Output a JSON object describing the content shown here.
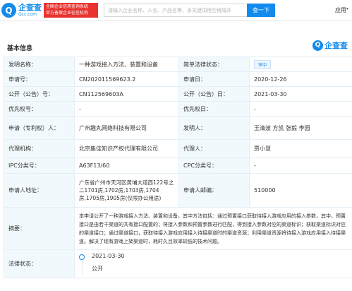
{
  "header": {
    "logo_mark": "Q",
    "logo_cn": "企查查",
    "logo_en": "Qcc.com",
    "banner_line1": "全国企业信用查询系统",
    "banner_line2": "官方备案企业征信机构",
    "search_placeholder": "请输入企业名称、人名、产品名等，多关键词用空格隔开",
    "search_button": "查一下",
    "app_link": "应用",
    "accent": "#128bed",
    "banner_color": "#e8332e"
  },
  "section": {
    "title": "基本信息",
    "brand_mark": "Q",
    "brand_text": "企查查"
  },
  "rows": {
    "r1": {
      "k1": "发明名称：",
      "v1": "一种游戏接入方法、装置和设备",
      "k2": "简单法律状态：",
      "v2": "审中"
    },
    "r2": {
      "k1": "申请号：",
      "v1": "CN202011569623.2",
      "k2": "申请日：",
      "v2": "2020-12-26"
    },
    "r3": {
      "k1": "公开（公告）号：",
      "v1": "CN112569603A",
      "k2": "公开（公告）日：",
      "v2": "2021-03-30"
    },
    "r4": {
      "k1": "优先权号：",
      "v1": "-",
      "k2": "优先权日：",
      "v2": "-"
    },
    "r5": {
      "k1": "申请（专利权）人：",
      "v1": "广州趣丸网络科技有限公司",
      "k2": "发明人：",
      "v2": "王清波 方凯 张毅 李园"
    },
    "r6": {
      "k1": "代理机构：",
      "v1": "北京集佳知识产权代理有限公司",
      "k2": "代理人：",
      "v2": "贾小慧"
    },
    "r7": {
      "k1": "IPC分类号：",
      "v1": "A63F13/60",
      "k2": "CPC分类号：",
      "v2": "-"
    },
    "r8": {
      "k1": "申请人地址：",
      "v1": "广东省广州市天河区黄埔大道西122号之二1701房,1702房,1703房,1704房,1705房,1905房(仅限办公用途)",
      "k2": "申请人邮编：",
      "v2": "510000"
    },
    "abstract_label": "摘要：",
    "abstract": "本申请公开了一种游戏接入方法、装置和设备，其中方法包括：通过预置接口获取待接入游戏应用的接入参数，其中，预置接口是由若干渠道的共有接口配置的；将接入参数和预置参数进行匹配，得到接入参数对应的渠道标识；获取渠道标识对应的渠道接口；通过渠道接口，获取待接入游戏应用接入待接渠道时的渠道资源；利用渠道资源将待接入游戏应用接入待接渠道。解决了现有游戏上架渠道时，耗时久且效率较低的技术问题。",
    "legal_label": "法律状态：",
    "legal_date": "2021-03-30",
    "legal_desc": "公开"
  }
}
